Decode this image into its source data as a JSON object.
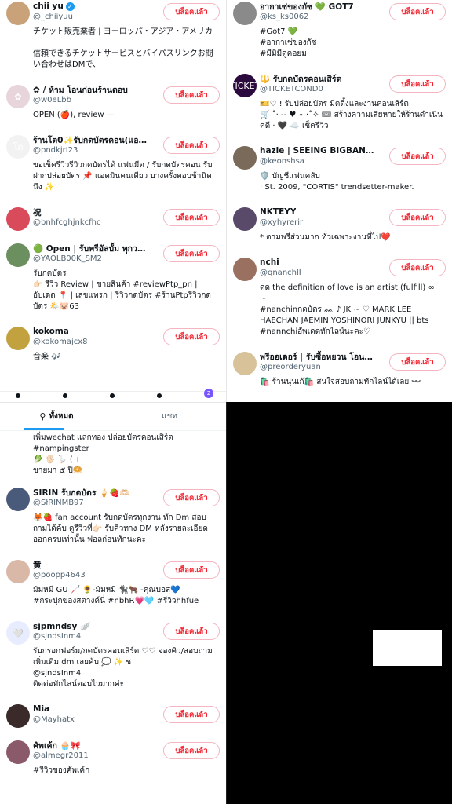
{
  "block_label": "บล็อคแล้ว",
  "panel_tl": {
    "items": [
      {
        "name": "chii yu",
        "verified": true,
        "handle": "@_chiiyuu",
        "bio": "チケット販売業者 | ヨーロッパ・アジア・アメリカ\n\n信頼できるチケットサービスとバイパスリンクお問い合わせはDMで、",
        "avatar_color": "#c9a27a",
        "avatar_glyph": ""
      },
      {
        "name": "✿ / ห้าม โอนก่อนร้านตอบ",
        "verified": false,
        "handle": "@w0eLbb",
        "bio": "OPEN (🍎), review —",
        "avatar_color": "#e8d5dc",
        "avatar_glyph": "✿"
      },
      {
        "name": "ร้านโต0✨รับกดบัตรคอน(แอดเ...",
        "verified": false,
        "handle": "@pndkjrI23",
        "bio": "ขอเช็ครีวิวรีวิวกดบัตรได้ แฟนมีต / รับกดบัตรคอน รับฝากปล่อยบัตร 📌 แอดมินคนเดียว บางครั้งตอบช้านิดนึง ✨",
        "avatar_color": "#f2f2f2",
        "avatar_glyph": "โต"
      },
      {
        "name": "祝",
        "verified": false,
        "handle": "@bnhfcghjnkcfhc",
        "bio": "",
        "avatar_color": "#d94a5a",
        "avatar_glyph": ""
      },
      {
        "name": "🟢 Open | รับพรีอัลบั้ม ทุกวง🎆...",
        "verified": false,
        "handle": "@YAOLB00K_SM2",
        "bio": "รับกดบัตร\n👉🏻 รีวิว Review | ขายสินค้า #reviewPtp_pn | อัปเดต 📍 | เลขแทรก | รีวิวกดบัตร #ร้านPtpรีวิวกดบัตร 🌤️🐷63",
        "avatar_color": "#6b8f5e",
        "avatar_glyph": ""
      },
      {
        "name": "kokoma",
        "verified": false,
        "handle": "@kokomajcx8",
        "bio": "音楽 🎶",
        "avatar_color": "#c2a13f",
        "avatar_glyph": ""
      }
    ]
  },
  "panel_tr": {
    "items": [
      {
        "name": "อากาเซ่ของกัซ 💚 GOT7",
        "verified": false,
        "handle": "@ks_ks0062",
        "bio": "#Got7 💚\n#อากาเซ่ของกัซ\n#มีมิมีดูคอยม",
        "avatar_color": "#8a8a8a",
        "avatar_glyph": ""
      },
      {
        "name": "🔱 รับกดบัตรคอนเสิร์ต",
        "verified": false,
        "handle": "@TICKETCOND0",
        "bio": "🎫♡ ! รับปล่อยบัตร มีดดิ้งและงานคอนเสิร์ต\n🛒 ˚‧ -- ♥ ⋆ ·˚✧ 🎟 สร้างความเสียหายให้ร้านดำเนินคดี · 🖤 ☁️ เช็ครีวิว",
        "avatar_color": "#2b0a3d",
        "avatar_glyph": "TICKET"
      },
      {
        "name": "hazie | SEEING BIGBANG IN J...",
        "verified": false,
        "handle": "@keonshsa",
        "bio": "🛡️ บัญชีแฟนคลับ\n· St. 2009, \"CORTIS\" trendsetter-maker.",
        "avatar_color": "#7a6a5a",
        "avatar_glyph": ""
      },
      {
        "name": "NKTEYY",
        "verified": false,
        "handle": "@xyhyrerir",
        "bio": "* ตามพรีส่วนมาก ทั่วเฉพาะงานที่ไป❤️",
        "avatar_color": "#5a4a6a",
        "avatar_glyph": ""
      },
      {
        "name": "nchi",
        "verified": false,
        "handle": "@qnanchlI",
        "bio": "ดด the definition of love is an artist (fulfill) ∞ ~\n#nanchinกดบัตร ᨐ ♪ JK ~ ♡ MARK LEE HAECHAN JAEMIN YOSHINORI JUNKYU || bts #nannchiอัพเดตทักไลน์นะคะ♡",
        "avatar_color": "#9a7060",
        "avatar_glyph": ""
      },
      {
        "name": "พรีออเดอร์ | รับซื้อหยวน โอนเงินจี...",
        "verified": false,
        "handle": "@preorderyuan",
        "bio": "🛍️ ร้านนุ่นเก๊🛍️ สนใจสอบถามทักไลน์ได้เลย 〰️",
        "avatar_color": "#d7c29a",
        "avatar_glyph": ""
      }
    ]
  },
  "panel_bl": {
    "tabs": [
      {
        "label": "ทั้งหมด",
        "active": true
      },
      {
        "label": "แชท",
        "active": false
      }
    ],
    "continued_text": "เพิ่มwechat แลกทอง ปล่อยบัตรคอนเสิร์ต\n#nampingster\n🥬 🖐🏻 🪿 ( 」\nขายมา ๕ ปี🥯",
    "items": [
      {
        "name": "SIRIN รับกดบัตร 🍦🍓🫶🏻",
        "verified": false,
        "handle": "@SłRINMB97",
        "bio": "🦊🍓 fan account รับกดบัตรทุกงาน ทัก Dm สอบถามได้ค้บ ดูรีวิวที่👉🏻 รับคิวทาง DM หลังรายละเอียดออกครบเท่านั้น ฟอลก่อนทักนะคะ",
        "avatar_color": "#4a5a7a",
        "avatar_glyph": ""
      },
      {
        "name": "黄",
        "verified": false,
        "handle": "@poopp4643",
        "bio": "มัมหมี GU 🦯 🌻-มัมหมี 🐈‍⬛🐂 -คุณบอส💙\n#กระปุกของสตางค์นี่ #nbhR💗🩵 #รีวิวhhfue",
        "avatar_color": "#d9b8a8",
        "avatar_glyph": ""
      },
      {
        "name": "sjpmndsy 🪽",
        "verified": false,
        "handle": "@sjndsInm4",
        "bio": "รับกรอกฟอร์ม/กดบัตรคอนเสิร์ต ♡♡ จองคิว/สอบถามเพิ่มเติม dm เลยค้บ 💭 ✨ ช\n@sjndsInm4\nติดต่อทักไลน์ตอบไวมากค่ะ",
        "avatar_color": "#e8ecff",
        "avatar_glyph": "🤍"
      },
      {
        "name": "Mia",
        "verified": false,
        "handle": "@Mayhatx",
        "bio": "",
        "avatar_color": "#3a2a2a",
        "avatar_glyph": ""
      },
      {
        "name": "คัพเค้ก 🧁🎀",
        "verified": false,
        "handle": "@almegr2011",
        "bio": "#รีวิวของคัพเค้ก",
        "avatar_color": "#8a5a6a",
        "avatar_glyph": ""
      }
    ]
  },
  "tl_bar": {
    "badge": "2"
  }
}
